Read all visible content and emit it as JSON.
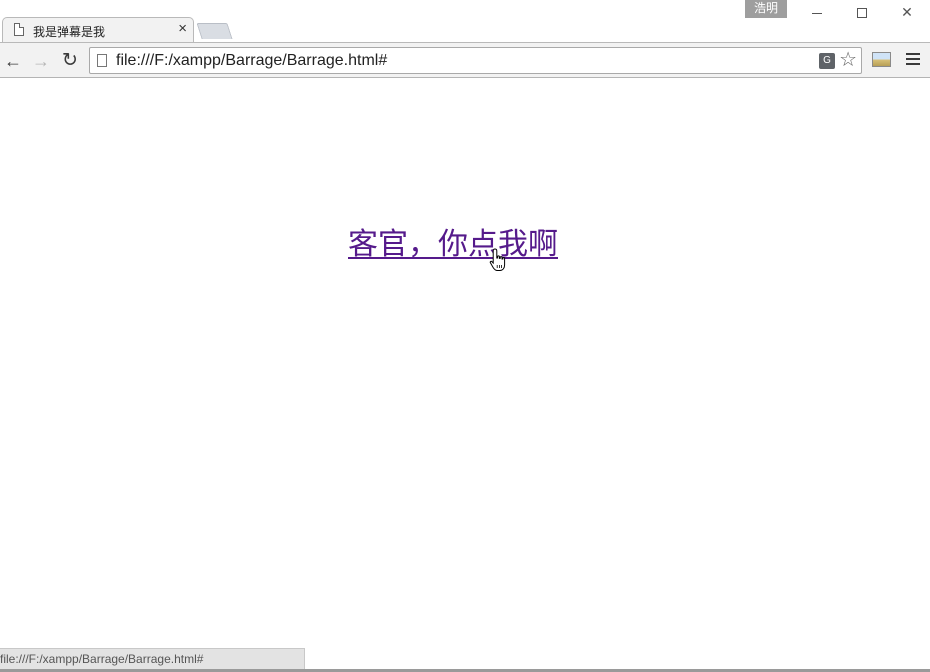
{
  "tab": {
    "title": "我是弹幕是我",
    "close_glyph": "×"
  },
  "profile": {
    "name": "浩明"
  },
  "window_controls": {
    "close_glyph": "✕"
  },
  "toolbar": {
    "back_glyph": "←",
    "forward_glyph": "→",
    "reload_glyph": "↻",
    "url": "file:///F:/xampp/Barrage/Barrage.html#",
    "translate_glyph": "G",
    "star_glyph": "☆"
  },
  "page": {
    "link_text": "客官，你点我啊",
    "link_color": "#551a8b"
  },
  "status": {
    "url": "file:///F:/xampp/Barrage/Barrage.html#"
  },
  "icons": [
    "page-icon",
    "tab-close-icon",
    "back-arrow-icon",
    "forward-arrow-icon",
    "reload-icon",
    "translate-icon",
    "bookmark-star-icon",
    "extension-image-icon",
    "menu-icon",
    "hand-cursor-icon"
  ]
}
